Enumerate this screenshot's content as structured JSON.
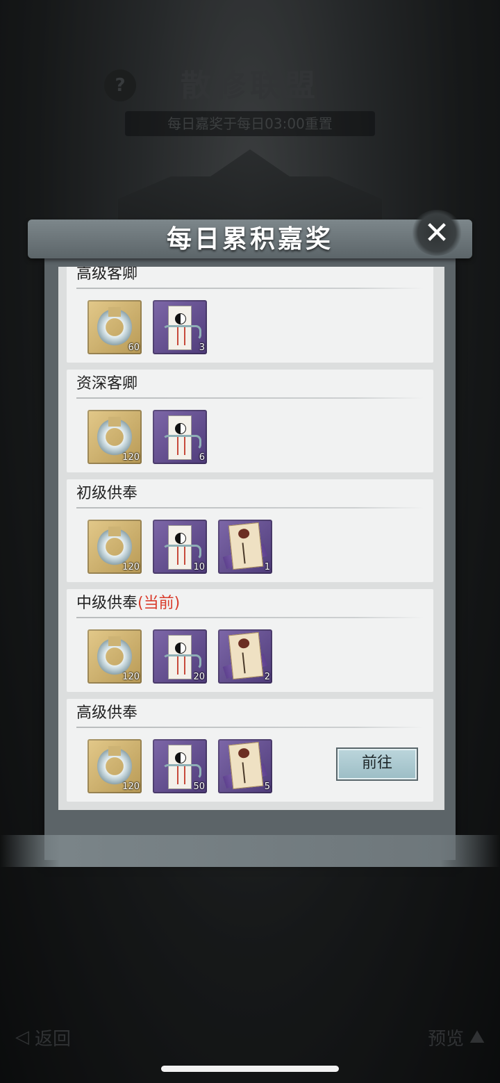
{
  "background": {
    "help_label": "?",
    "title": "散修联盟",
    "reset_notice": "每日嘉奖于每日03:00重置",
    "back_label": "返回",
    "preview_label": "预览"
  },
  "modal": {
    "title": "每日累积嘉奖",
    "close_label": "✕",
    "go_button_label": "前往",
    "tiers": [
      {
        "name": "高级客卿",
        "current_tag": "",
        "items": [
          {
            "icon": "jade-ring-icon",
            "qty": "60"
          },
          {
            "icon": "talisman-icon",
            "qty": "3"
          }
        ]
      },
      {
        "name": "资深客卿",
        "current_tag": "",
        "items": [
          {
            "icon": "jade-ring-icon",
            "qty": "120"
          },
          {
            "icon": "talisman-icon",
            "qty": "6"
          }
        ]
      },
      {
        "name": "初级供奉",
        "current_tag": "",
        "items": [
          {
            "icon": "jade-ring-icon",
            "qty": "120"
          },
          {
            "icon": "talisman-icon",
            "qty": "10"
          },
          {
            "icon": "paw-scroll-icon",
            "qty": "1"
          }
        ]
      },
      {
        "name": "中级供奉",
        "current_tag": "(当前)",
        "items": [
          {
            "icon": "jade-ring-icon",
            "qty": "120"
          },
          {
            "icon": "talisman-icon",
            "qty": "20"
          },
          {
            "icon": "paw-scroll-icon",
            "qty": "2"
          }
        ]
      },
      {
        "name": "高级供奉",
        "current_tag": "",
        "items": [
          {
            "icon": "jade-ring-icon",
            "qty": "120"
          },
          {
            "icon": "talisman-icon",
            "qty": "50"
          },
          {
            "icon": "paw-scroll-icon",
            "qty": "5"
          }
        ]
      }
    ]
  },
  "colors": {
    "current_tag": "#d93a2a",
    "item_gold": "#c9ad6a",
    "item_purple": "#65508f"
  }
}
